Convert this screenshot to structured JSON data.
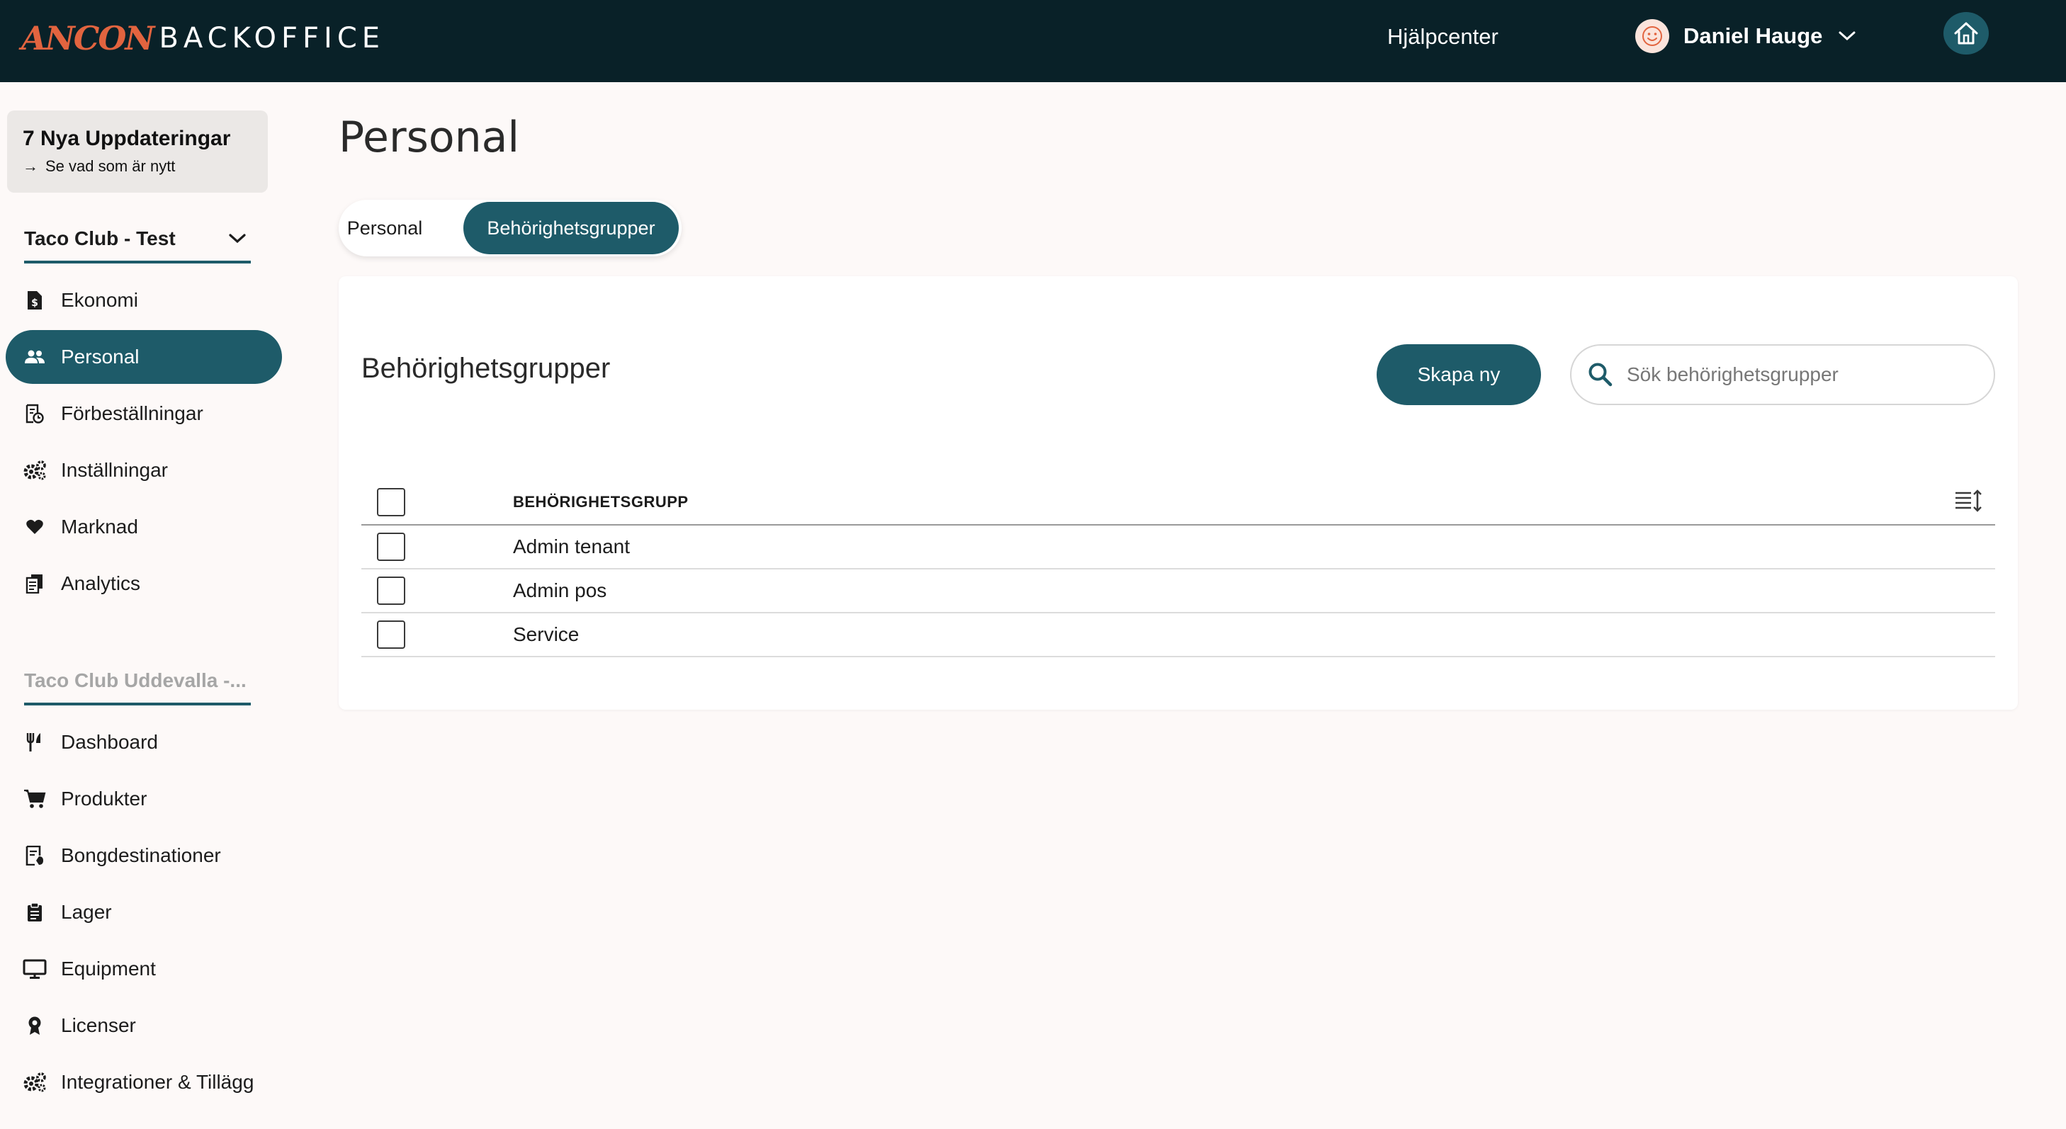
{
  "header": {
    "logo_brand": "ANCON",
    "logo_sub": "BACKOFFICE",
    "help_label": "Hjälpcenter",
    "user_name": "Daniel Hauge",
    "icons": {
      "avatar": "smiley-avatar-icon",
      "chevron": "chevron-down-icon",
      "home": "home-icon"
    }
  },
  "sidebar": {
    "updates": {
      "title": "7 Nya Uppdateringar",
      "subtitle": "Se vad som är nytt",
      "arrow": "→"
    },
    "org_primary": "Taco Club - Test",
    "primary_items": [
      {
        "label": "Ekonomi",
        "icon": "dollar-document-icon"
      },
      {
        "label": "Personal",
        "icon": "people-icon",
        "active": true
      },
      {
        "label": "Förbeställningar",
        "icon": "receipt-clock-icon"
      },
      {
        "label": "Inställningar",
        "icon": "gears-icon"
      },
      {
        "label": "Marknad",
        "icon": "heart-icon"
      },
      {
        "label": "Analytics",
        "icon": "report-stack-icon"
      }
    ],
    "org_secondary": "Taco Club Uddevalla -...",
    "secondary_items": [
      {
        "label": "Dashboard",
        "icon": "fork-knife-icon"
      },
      {
        "label": "Produkter",
        "icon": "cart-icon"
      },
      {
        "label": "Bongdestinationer",
        "icon": "ticket-icon"
      },
      {
        "label": "Lager",
        "icon": "clipboard-icon"
      },
      {
        "label": "Equipment",
        "icon": "monitor-icon"
      },
      {
        "label": "Licenser",
        "icon": "award-icon"
      },
      {
        "label": "Integrationer & Tillägg",
        "icon": "gears-icon"
      }
    ]
  },
  "main": {
    "page_title": "Personal",
    "tabs": [
      {
        "label": "Personal",
        "active": false
      },
      {
        "label": "Behörighetsgrupper",
        "active": true
      }
    ],
    "card": {
      "title": "Behörighetsgrupper",
      "create_label": "Skapa ny",
      "search_placeholder": "Sök behörighetsgrupper",
      "column_header": "BEHÖRIGHETSGRUPP",
      "rows": [
        {
          "name": "Admin tenant"
        },
        {
          "name": "Admin pos"
        },
        {
          "name": "Service"
        }
      ]
    }
  },
  "colors": {
    "topbar": "#092128",
    "accent": "#1e5b69",
    "brand_orange": "#e2643f",
    "background": "#fdf9f8"
  }
}
